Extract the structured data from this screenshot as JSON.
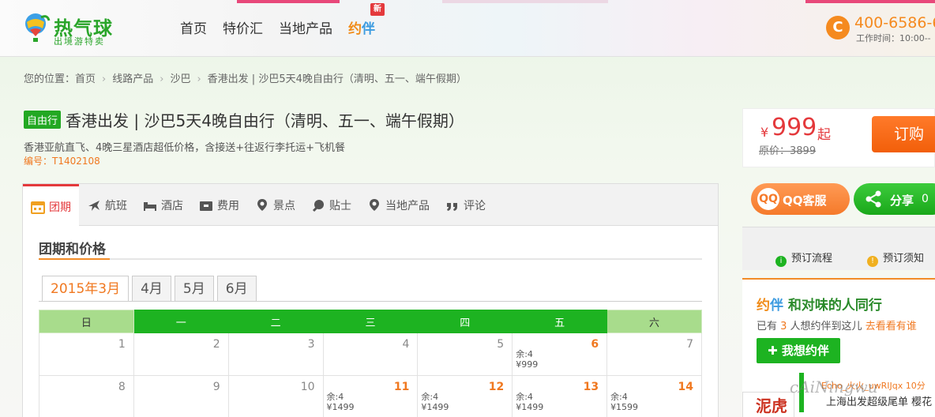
{
  "header": {
    "brand": "热气球",
    "slogan": "出境游特卖",
    "nav": [
      {
        "label": "首页"
      },
      {
        "label": "特价汇"
      },
      {
        "label": "当地产品"
      }
    ],
    "yueban": {
      "y": "约",
      "b": "伴",
      "badge": "新"
    },
    "hotline": {
      "number": "400-6586-6",
      "hours": "工作时间：10:00--"
    }
  },
  "breadcrumb": {
    "prefix": "您的位置：",
    "items": [
      "首页",
      "线路产品",
      "沙巴",
      "香港出发 | 沙巴5天4晚自由行（清明、五一、端午假期）"
    ],
    "sep": "›"
  },
  "product": {
    "tag": "自由行",
    "title": "香港出发 | 沙巴5天4晚自由行（清明、五一、端午假期）",
    "subtitle": "香港亚航直飞、4晚三星酒店超低价格，含接送+往返行李托运+飞机餐",
    "code": "编号：T1402108"
  },
  "price": {
    "currency": "¥",
    "amount": "999",
    "suffix": "起",
    "original": "原价：3899",
    "order_label": "订购"
  },
  "tabs": [
    {
      "label": "团期",
      "icon": "calendar-icon"
    },
    {
      "label": "航班",
      "icon": "plane-icon"
    },
    {
      "label": "酒店",
      "icon": "bed-icon"
    },
    {
      "label": "费用",
      "icon": "wallet-icon"
    },
    {
      "label": "景点",
      "icon": "location-pin-icon"
    },
    {
      "label": "贴士",
      "icon": "tips-icon"
    },
    {
      "label": "当地产品",
      "icon": "local-product-icon"
    },
    {
      "label": "评论",
      "icon": "quote-icon"
    }
  ],
  "section_title": "团期和价格",
  "months": [
    "2015年3月",
    "4月",
    "5月",
    "6月"
  ],
  "calendar": {
    "weekdays": [
      "日",
      "一",
      "二",
      "三",
      "四",
      "五",
      "六"
    ],
    "weeks": [
      [
        {
          "day": "1"
        },
        {
          "day": "2"
        },
        {
          "day": "3"
        },
        {
          "day": "4"
        },
        {
          "day": "5"
        },
        {
          "day": "6",
          "remain": "余:4",
          "price": "¥999"
        },
        {
          "day": "7"
        }
      ],
      [
        {
          "day": "8"
        },
        {
          "day": "9"
        },
        {
          "day": "10"
        },
        {
          "day": "11",
          "remain": "余:4",
          "price": "¥1499"
        },
        {
          "day": "12",
          "remain": "余:4",
          "price": "¥1499"
        },
        {
          "day": "13",
          "remain": "余:4",
          "price": "¥1499"
        },
        {
          "day": "14",
          "remain": "余:4",
          "price": "¥1599"
        }
      ]
    ]
  },
  "sidebar": {
    "qq_label": "QQ客服",
    "qq_icon_text": "QQ",
    "share_label": "分享",
    "share_count": "0",
    "notice": {
      "flow": "预订流程",
      "notes": "预订须知"
    },
    "yueban": {
      "y": "约",
      "b": "伴",
      "head_text": " 和对味的人同行",
      "stat_prefix": "已有 ",
      "stat_num": "3",
      "stat_mid": " 人想约伴到这儿 ",
      "stat_link": "去看看有谁",
      "want_label": "我想约伴",
      "feed_user": "Echo_火火_uwRIJqx 10分",
      "feed_msg": "上海出发超级尾单 樱花"
    },
    "ad_text": "泥虎"
  },
  "watermark": "cAiNingwu"
}
